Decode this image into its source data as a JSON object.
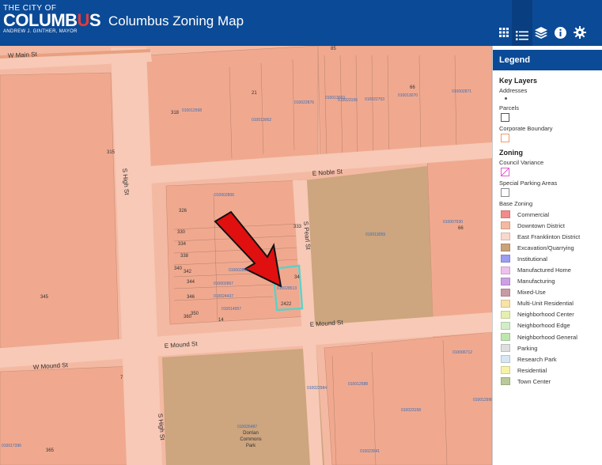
{
  "header": {
    "logo_top": "THE CITY OF",
    "logo_main_a": "COLUMB",
    "logo_main_b": "U",
    "logo_main_c": "S",
    "logo_sub": "ANDREW J. GINTHER, MAYOR",
    "title": "Columbus Zoning Map"
  },
  "toolbar": [
    {
      "name": "basemap-gallery-icon",
      "glyph": "▦"
    },
    {
      "name": "legend-list-icon",
      "glyph": "☰"
    },
    {
      "name": "layers-icon",
      "glyph": "◈"
    },
    {
      "name": "info-icon",
      "glyph": "ⓘ"
    },
    {
      "name": "settings-icon",
      "glyph": "⚙"
    }
  ],
  "streets": {
    "w_main": "W Main St",
    "e_noble": "E Noble St",
    "s_high_north": "S High St",
    "s_pearl": "S Pearl St",
    "e_mound": "E Mound St",
    "e_mound_west": "E Mound St",
    "w_mound": "W Mound St",
    "s_high_south": "S High St"
  },
  "map_labels": {
    "park": [
      "Dorrian",
      "Commons",
      "Park"
    ],
    "addresses": [
      "315",
      "326",
      "330",
      "334",
      "338",
      "340",
      "342",
      "344",
      "346",
      "350",
      "345",
      "333",
      "360",
      "2422",
      "14",
      "21",
      "66",
      "318",
      "7",
      "365",
      "85",
      "34",
      "66"
    ],
    "parcels": [
      "010012568",
      "010013062",
      "010022876",
      "010013063",
      "010023156",
      "010022753",
      "010013070",
      "010002871",
      "010002806",
      "010013059",
      "010007930",
      "010002866",
      "010002867",
      "010024437",
      "010014957",
      "010028513",
      "010022984",
      "010012588",
      "010023158",
      "010006712",
      "010012996",
      "010026487",
      "010023041",
      "010017396"
    ]
  },
  "legend": {
    "title": "Legend",
    "key_layers": "Key Layers",
    "addresses": "Addresses",
    "parcels": "Parcels",
    "corporate_boundary": "Corporate Boundary",
    "zoning": "Zoning",
    "council_variance": "Council Variance",
    "special_parking": "Special Parking Areas",
    "base_zoning": "Base Zoning",
    "items": [
      {
        "label": "Commercial",
        "color": "#f28b8b"
      },
      {
        "label": "Downtown District",
        "color": "#f4b9a2"
      },
      {
        "label": "East Franklinton District",
        "color": "#f8d7cc"
      },
      {
        "label": "Excavation/Quarrying",
        "color": "#c9a37a"
      },
      {
        "label": "Institutional",
        "color": "#9c9cf0"
      },
      {
        "label": "Manufactured Home",
        "color": "#eec0ec"
      },
      {
        "label": "Manufacturing",
        "color": "#cda0e6"
      },
      {
        "label": "Mixed-Use",
        "color": "#c99aa6"
      },
      {
        "label": "Multi-Unit Residential",
        "color": "#f7e2a8"
      },
      {
        "label": "Neighborhood Center",
        "color": "#e5f0b0"
      },
      {
        "label": "Neighborhood Edge",
        "color": "#d3edc9"
      },
      {
        "label": "Neighborhood General",
        "color": "#c0e6b0"
      },
      {
        "label": "Parking",
        "color": "#dedede"
      },
      {
        "label": "Research Park",
        "color": "#d6e6f2"
      },
      {
        "label": "Residential",
        "color": "#f6f3a8"
      },
      {
        "label": "Town Center",
        "color": "#b9c99a"
      }
    ]
  }
}
